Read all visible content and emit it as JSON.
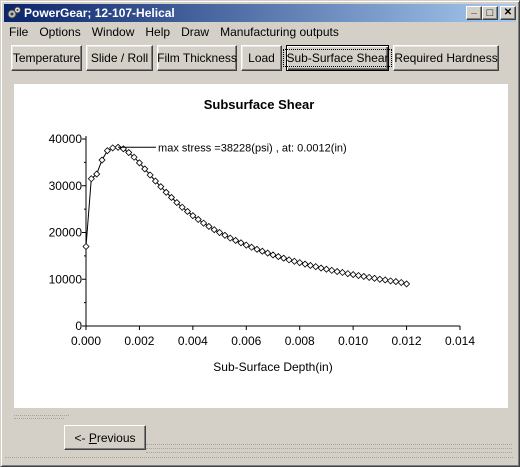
{
  "window": {
    "title": "PowerGear;  12-107-Helical",
    "minimize_glyph": "_",
    "maximize_glyph": "□",
    "close_glyph": "✕"
  },
  "menu": [
    "File",
    "Options",
    "Window",
    "Help",
    "Draw",
    "Manufacturing outputs"
  ],
  "tabs": [
    {
      "label": "Temperature",
      "active": false
    },
    {
      "label": "Slide / Roll",
      "active": false
    },
    {
      "label": "Film Thickness",
      "active": false
    },
    {
      "label": "Load",
      "active": false
    },
    {
      "label": "Sub-Surface Shear",
      "active": true
    },
    {
      "label": "Required Hardness",
      "active": false
    }
  ],
  "previous_button": {
    "prefix": "<- ",
    "underlined": "P",
    "rest": "revious"
  },
  "chart_data": {
    "type": "line",
    "title": "Subsurface Shear",
    "xlabel": "Sub-Surface Depth(in)",
    "ylabel": "",
    "xlim": [
      0,
      0.014
    ],
    "ylim": [
      0,
      40000
    ],
    "x_ticks": [
      "0.000",
      "0.002",
      "0.004",
      "0.006",
      "0.008",
      "0.010",
      "0.012",
      "0.014"
    ],
    "y_ticks": [
      "0",
      "10000",
      "20000",
      "30000",
      "40000"
    ],
    "annotation": "max stress =38228(psi) , at: 0.0012(in)",
    "annotation_point": [
      0.0012,
      38228
    ],
    "series": [
      {
        "marker": "diamond",
        "x": [
          0.0,
          0.0002,
          0.0004,
          0.0006,
          0.0008,
          0.001,
          0.0012,
          0.0014,
          0.0016,
          0.0018,
          0.002,
          0.0022,
          0.0024,
          0.0026,
          0.0028,
          0.003,
          0.0032,
          0.0034,
          0.0036,
          0.0038,
          0.004,
          0.0042,
          0.0044,
          0.0046,
          0.0048,
          0.005,
          0.0052,
          0.0054,
          0.0056,
          0.0058,
          0.006,
          0.0062,
          0.0064,
          0.0066,
          0.0068,
          0.007,
          0.0072,
          0.0074,
          0.0076,
          0.0078,
          0.008,
          0.0082,
          0.0084,
          0.0086,
          0.0088,
          0.009,
          0.0092,
          0.0094,
          0.0096,
          0.0098,
          0.01,
          0.0102,
          0.0104,
          0.0106,
          0.0108,
          0.011,
          0.0112,
          0.0114,
          0.0116,
          0.0118,
          0.012
        ],
        "y": [
          17000,
          31500,
          32500,
          35500,
          37500,
          38100,
          38228,
          37900,
          37100,
          36100,
          34900,
          33600,
          32300,
          31000,
          29800,
          28600,
          27500,
          26400,
          25400,
          24500,
          23600,
          22800,
          22000,
          21300,
          20600,
          20000,
          19400,
          18800,
          18300,
          17800,
          17300,
          16850,
          16400,
          16000,
          15600,
          15200,
          14850,
          14500,
          14150,
          13850,
          13550,
          13250,
          12950,
          12700,
          12400,
          12150,
          11900,
          11650,
          11450,
          11200,
          11000,
          10800,
          10600,
          10400,
          10200,
          10000,
          9850,
          9650,
          9500,
          9300,
          9000
        ]
      }
    ]
  }
}
